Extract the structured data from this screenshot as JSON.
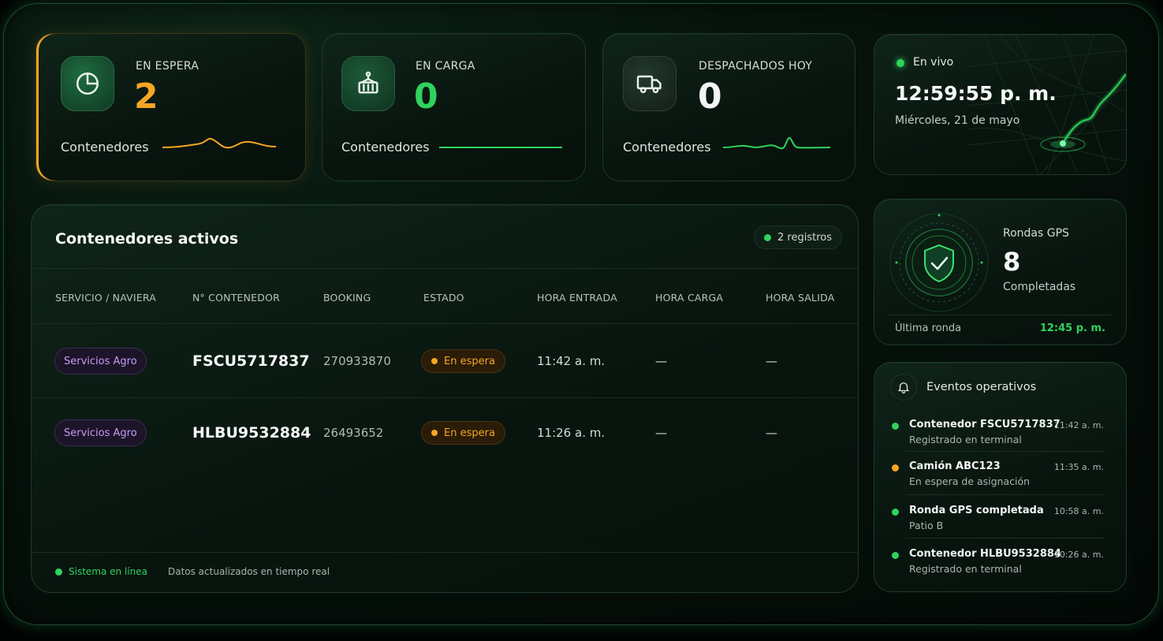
{
  "colors": {
    "accent_green": "#2fd35c",
    "accent_orange": "#f5a623",
    "purple": "#c79cf2",
    "text": "#e8efe9"
  },
  "stats": [
    {
      "label": "EN ESPERA",
      "value": "2",
      "sub": "Contenedores",
      "icon": "pie-chart-icon",
      "color": "#f5a623"
    },
    {
      "label": "EN CARGA",
      "value": "0",
      "sub": "Contenedores",
      "icon": "container-crane-icon",
      "color": "#2fd35c"
    },
    {
      "label": "DESPACHADOS HOY",
      "value": "0",
      "sub": "Contenedores",
      "icon": "truck-icon",
      "color": "#f2f5f3"
    }
  ],
  "live": {
    "label": "En vivo",
    "clock": "12:59:55 p. m.",
    "date": "Miércoles, 21 de mayo"
  },
  "gps": {
    "title": "Rondas GPS",
    "count": "8",
    "sub": "Completadas",
    "last_label": "Última ronda",
    "last_time": "12:45 p. m.",
    "icon": "shield-check-icon"
  },
  "table": {
    "title": "Contenedores activos",
    "badge": "2 registros",
    "headers": [
      "SERVICIO / NAVIERA",
      "N° CONTENEDOR",
      "BOOKING",
      "ESTADO",
      "HORA ENTRADA",
      "HORA CARGA",
      "HORA SALIDA"
    ],
    "rows": [
      {
        "service": "Servicios Agro",
        "container": "FSCU5717837",
        "booking": "270933870",
        "status": "En espera",
        "entry": "11:42 a. m.",
        "load": "—",
        "exit": "—"
      },
      {
        "service": "Servicios Agro",
        "container": "HLBU9532884",
        "booking": "26493652",
        "status": "En espera",
        "entry": "11:26 a. m.",
        "load": "—",
        "exit": "—"
      }
    ],
    "footer_status": "Sistema en línea",
    "footer_note": "Datos actualizados en tiempo real"
  },
  "events": {
    "title": "Eventos operativos",
    "icon": "bell-icon",
    "items": [
      {
        "title": "Contenedor FSCU5717837",
        "sub": "Registrado en terminal",
        "time": "11:42 a. m.",
        "color": "#2fd35c"
      },
      {
        "title": "Camión ABC123",
        "sub": "En espera de asignación",
        "time": "11:35 a. m.",
        "color": "#f5a623"
      },
      {
        "title": "Ronda GPS completada",
        "sub": "Patio B",
        "time": "10:58 a. m.",
        "color": "#2fd35c"
      },
      {
        "title": "Contenedor HLBU9532884",
        "sub": "Registrado en terminal",
        "time": "10:26 a. m.",
        "color": "#2fd35c"
      }
    ]
  }
}
